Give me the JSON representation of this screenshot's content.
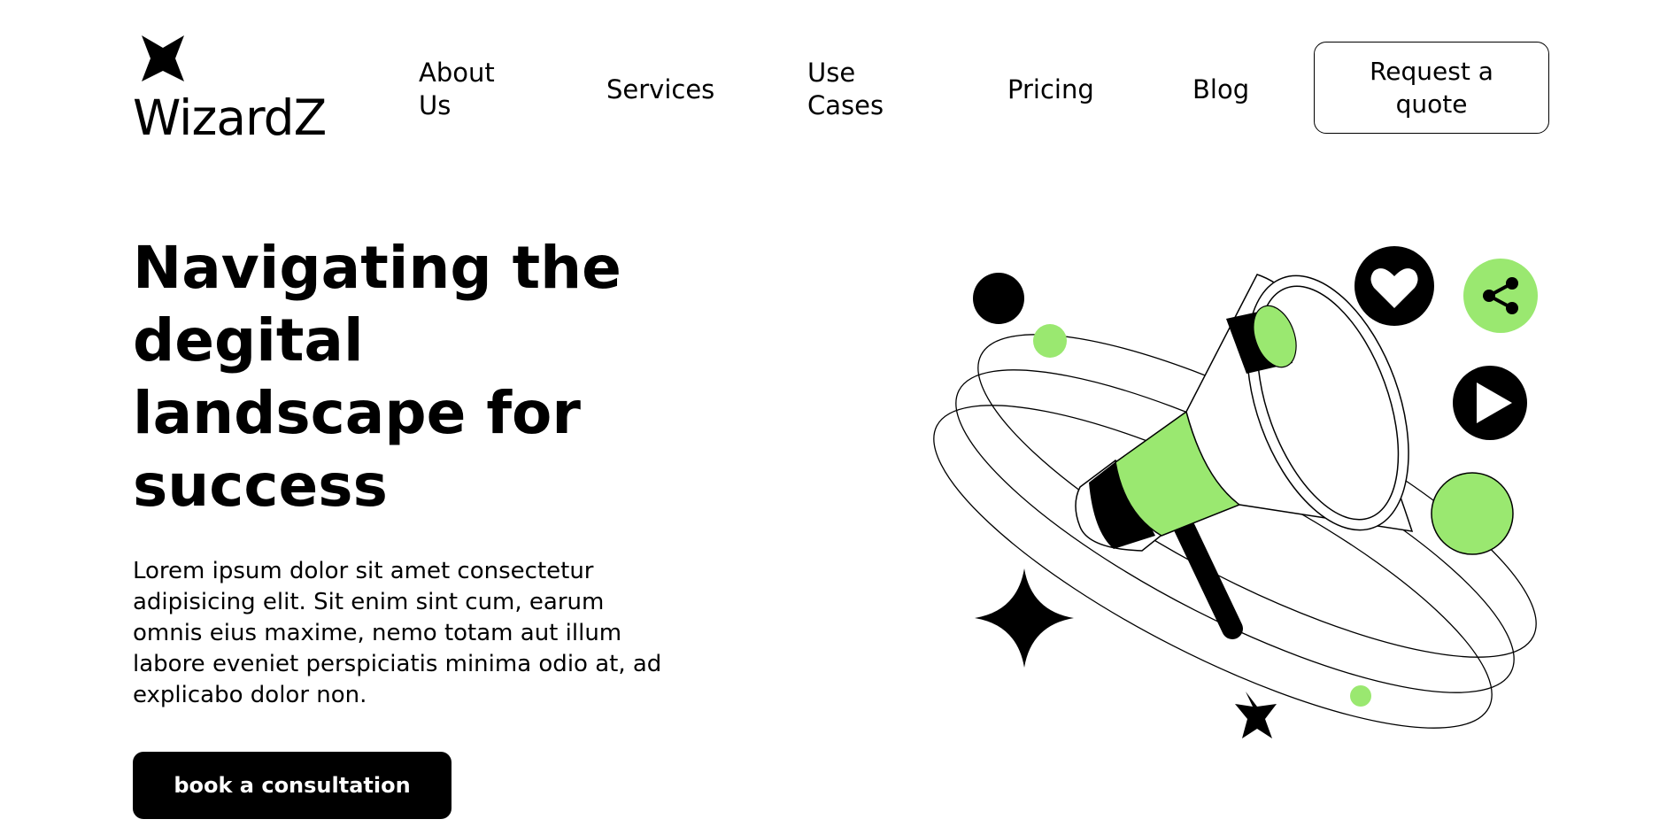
{
  "brand": {
    "name": "WizardZ"
  },
  "nav": {
    "items": [
      {
        "label": "About Us"
      },
      {
        "label": "Services"
      },
      {
        "label": "Use Cases"
      },
      {
        "label": "Pricing"
      },
      {
        "label": "Blog"
      }
    ],
    "cta_label": "Request a quote"
  },
  "hero": {
    "title": "Navigating the degital landscape for success",
    "description": "Lorem ipsum dolor sit amet consectetur adipisicing elit. Sit enim sint cum, earum omnis eius maxime, nemo totam aut illum labore eveniet perspiciatis minima odio at, ad explicabo dolor non.",
    "cta_label": "book a consultation"
  },
  "illustration": {
    "icons": [
      "megaphone-icon",
      "heart-icon",
      "share-icon",
      "play-icon",
      "sparkle-star-icon"
    ]
  },
  "colors": {
    "accent": "#9AE870",
    "dark": "#000000",
    "background": "#FFFFFF"
  }
}
